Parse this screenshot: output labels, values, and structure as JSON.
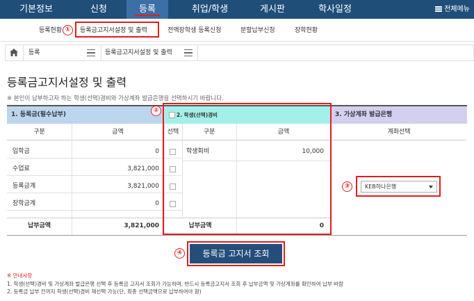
{
  "topnav": {
    "items": [
      "기본정보",
      "신청",
      "등록",
      "취업/학생",
      "게시판",
      "학사일정"
    ],
    "active_index": 2,
    "menu_all_label": "전체메뉴"
  },
  "subnav": {
    "items": [
      "등록현황",
      "등록금고지서설정 및 출력",
      "전액장학생 등록신청",
      "분할납부신청",
      "장학현황"
    ],
    "active_index": 1
  },
  "breadcrumb": {
    "home_icon": "home-icon",
    "level1": "등록",
    "level2": "등록금고지서설정 및 출력"
  },
  "page": {
    "title": "등록금고지서설정 및 출력",
    "description": "※ 본인이 납부하고자 하는 학생(선택)경비와 가상계좌 발급은행을 선택하시기 바랍니다."
  },
  "section1": {
    "header": "1. 등록금(필수납부)",
    "col_type": "구분",
    "col_amount": "금액",
    "rows": [
      {
        "label": "입학금",
        "amount": "0"
      },
      {
        "label": "수업료",
        "amount": "3,821,000"
      },
      {
        "label": "등록금계",
        "amount": "3,821,000"
      },
      {
        "label": "장학금계",
        "amount": "0"
      }
    ],
    "total_label": "납부금액",
    "total_amount": "3,821,000"
  },
  "section2": {
    "header": "2. 학생(선택)경비",
    "col_select": "선택",
    "col_type": "구분",
    "col_amount": "금액",
    "rows": [
      {
        "label": "학생회비",
        "amount": "10,000"
      }
    ],
    "total_label": "납부금액",
    "total_amount": "0"
  },
  "section3": {
    "header": "3. 가상계좌 발급은행",
    "col_account": "계좌선택",
    "selected_bank": "KEB하나은행"
  },
  "actions": {
    "view_button": "등록금 고지서 조회"
  },
  "notice": {
    "title": "※ 안내사항",
    "lines": [
      "1. 학생(선택)경비 및 가상계좌 발급은행 선택 후 등록금 고지서 조회가 가능하며, 반드시 등록금고지서 조회 후 납부금액 및 가상계좌를 확인하여 납부 바람",
      "2. 등록금 납부 전까지 학생(선택)경비 재선택 가능(단, 최종 선택금액으로 납부하여야 함)"
    ]
  },
  "annotations": [
    "①",
    "②",
    "③",
    "④"
  ],
  "colors": {
    "nav_bg": "#1f4e79",
    "nav_active": "#3c6fa6",
    "section1_head": "#bcd6ee",
    "section2_head": "#a3f0ea",
    "section3_head": "#d3cfee",
    "highlight_red": "#e31c1c",
    "button_bg": "#244d7a"
  }
}
